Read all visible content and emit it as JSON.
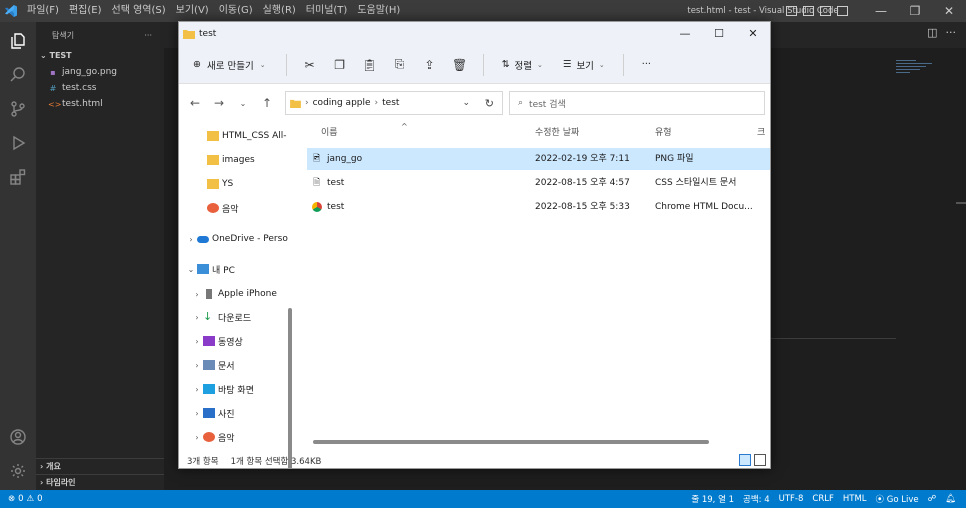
{
  "vscode": {
    "menu": [
      "파일(F)",
      "편집(E)",
      "선택 영역(S)",
      "보기(V)",
      "이동(G)",
      "실행(R)",
      "터미널(T)",
      "도움말(H)"
    ],
    "window_title": "test.html - test - Visual Studio Code",
    "sidebar": {
      "header": "탐색기",
      "more": "···",
      "folder": "TEST",
      "files": [
        {
          "name": "jang_go.png",
          "icon": "image-file-icon",
          "color": "#a074c4"
        },
        {
          "name": "test.css",
          "icon": "css-file-icon",
          "color": "#519aba"
        },
        {
          "name": "test.html",
          "icon": "html-file-icon",
          "color": "#e37933"
        }
      ],
      "outline": "개요",
      "timeline": "타임라인"
    },
    "statusbar": {
      "errors": "0",
      "warnings": "0",
      "position": "줄 19, 열 1",
      "spaces": "공백: 4",
      "encoding": "UTF-8",
      "eol": "CRLF",
      "language": "HTML",
      "golive": "Go Live"
    },
    "accent": "#007acc"
  },
  "explorer": {
    "title": "test",
    "new_label": "새로 만들기",
    "sort_label": "정렬",
    "view_label": "보기",
    "more": "···",
    "breadcrumb": [
      "coding apple",
      "test"
    ],
    "search_placeholder": "test 검색",
    "nav": [
      {
        "label": "HTML_CSS All-",
        "icon": "folder-icon"
      },
      {
        "label": "images",
        "icon": "folder-icon"
      },
      {
        "label": "YS",
        "icon": "folder-icon"
      },
      {
        "label": "음악",
        "icon": "music-icon"
      },
      {
        "label": "OneDrive - Perso",
        "icon": "cloud-icon"
      },
      {
        "label": "내 PC",
        "icon": "pc-icon"
      },
      {
        "label": "Apple iPhone",
        "icon": "phone-icon"
      },
      {
        "label": "다운로드",
        "icon": "download-icon"
      },
      {
        "label": "동영상",
        "icon": "video-icon"
      },
      {
        "label": "문서",
        "icon": "document-icon"
      },
      {
        "label": "바탕 화면",
        "icon": "desktop-icon"
      },
      {
        "label": "사진",
        "icon": "picture-icon"
      },
      {
        "label": "음악",
        "icon": "music-icon"
      }
    ],
    "columns": [
      "이름",
      "수정한 날짜",
      "유형",
      "크기"
    ],
    "files": [
      {
        "name": "jang_go",
        "date": "2022-02-19 오후 7:11",
        "type": "PNG 파일",
        "icon": "png-file-icon",
        "selected": true
      },
      {
        "name": "test",
        "date": "2022-08-15 오후 4:57",
        "type": "CSS 스타일시트 문서",
        "icon": "css-doc-icon",
        "selected": false
      },
      {
        "name": "test",
        "date": "2022-08-15 오후 5:33",
        "type": "Chrome HTML Docu...",
        "icon": "chrome-icon",
        "selected": false
      }
    ],
    "status": {
      "count": "3개 항목",
      "selection": "1개 항목 선택함 3.64KB"
    }
  }
}
